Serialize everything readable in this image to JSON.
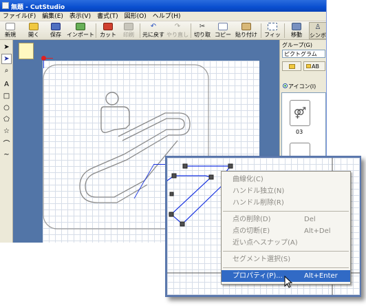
{
  "window": {
    "title": "無題 - CutStudio"
  },
  "menubar": [
    "ファイル(F)",
    "編集(E)",
    "表示(V)",
    "書式(T)",
    "図形(O)",
    "ヘルプ(H)"
  ],
  "toolbar": {
    "new": "新規",
    "open": "開く",
    "save": "保存",
    "import": "インポート",
    "cut": "カット",
    "print": "印刷",
    "undo": "元に戻す",
    "redo": "やり直し",
    "copy_cut": "切り取り",
    "copy": "コピー",
    "paste": "貼り付け",
    "fit": "フィット",
    "move": "移動",
    "simple": "シンボ"
  },
  "tools": {
    "text": "A"
  },
  "right_panel": {
    "group_label": "グループ(G)",
    "group_value": "ピクトグラム",
    "btn_ab": "AB",
    "radio_icon": "アイコン(I)",
    "thumb_number": "03"
  },
  "context_menu": {
    "items": [
      {
        "label": "曲線化(C)",
        "shortcut": "",
        "enabled": false
      },
      {
        "label": "ハンドル独立(N)",
        "shortcut": "",
        "enabled": false
      },
      {
        "label": "ハンドル削除(R)",
        "shortcut": "",
        "enabled": false
      },
      {
        "label": "点の削除(D)",
        "shortcut": "Del",
        "enabled": false
      },
      {
        "label": "点の切断(E)",
        "shortcut": "Alt+Del",
        "enabled": false
      },
      {
        "label": "近い点へスナップ(A)",
        "shortcut": "",
        "enabled": false
      },
      {
        "label": "セグメント選択(S)",
        "shortcut": "",
        "enabled": false
      },
      {
        "label": "プロパティ(P)...",
        "shortcut": "Alt+Enter",
        "enabled": true,
        "highlighted": true
      }
    ]
  },
  "colors": {
    "title_bar": "#0a4fd0",
    "workspace": "#5275a7",
    "highlight": "#316ac5",
    "path_selected": "#1530e0"
  }
}
